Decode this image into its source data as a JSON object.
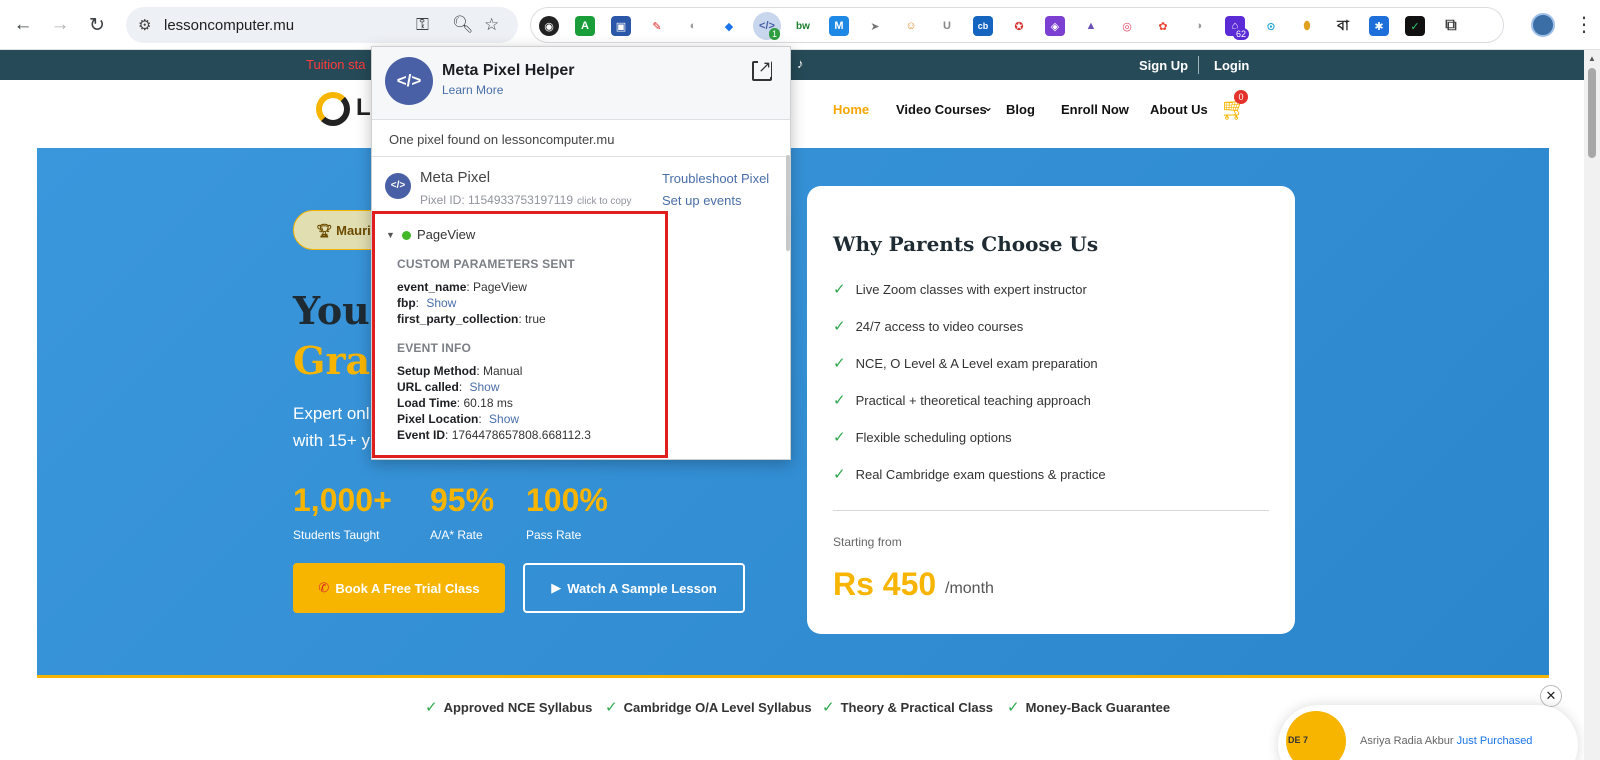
{
  "browser": {
    "url": "lessoncomputer.mu",
    "extension_badges": {
      "pixel": "1",
      "counter": "62"
    }
  },
  "site": {
    "announcement": "Tuition sta",
    "auth": {
      "signup": "Sign Up",
      "login": "Login"
    },
    "logo_text": "L",
    "nav": [
      {
        "label": "Home",
        "active": true
      },
      {
        "label": "Video Courses"
      },
      {
        "label": "Blog"
      },
      {
        "label": "Enroll Now"
      },
      {
        "label": "About Us"
      }
    ],
    "cart_count": "0"
  },
  "hero": {
    "pill_label": "Mauri",
    "heading_line1": "You",
    "heading_line2": "Grad",
    "subtitle_line1": "Expert onl",
    "subtitle_line2": "with 15+ y",
    "stats": [
      {
        "value": "1,000+",
        "label": "Students Taught"
      },
      {
        "value": "95%",
        "label": "A/A* Rate"
      },
      {
        "value": "100%",
        "label": "Pass Rate"
      }
    ],
    "cta_primary": "Book A Free Trial Class",
    "cta_secondary": "Watch A Sample Lesson"
  },
  "card": {
    "title": "Why Parents Choose Us",
    "features": [
      "Live Zoom classes with expert instructor",
      "24/7 access to video courses",
      "NCE, O Level & A Level exam preparation",
      "Practical + theoretical teaching approach",
      "Flexible scheduling options",
      "Real Cambridge exam questions & practice"
    ],
    "from_label": "Starting from",
    "price": "Rs 450",
    "price_unit": "/month"
  },
  "trust_bar": [
    "Approved NCE Syllabus",
    "Cambridge O/A Level Syllabus",
    "Theory & Practical Class",
    "Money-Back Guarantee"
  ],
  "toast": {
    "image_text": "DE 7",
    "name": "Asriya Radia Akbur",
    "action": "Just Purchased"
  },
  "pixel_helper": {
    "title": "Meta Pixel Helper",
    "learn_more": "Learn More",
    "found_text": "One pixel found on lessoncomputer.mu",
    "pixel_name": "Meta Pixel",
    "pixel_id": "Pixel ID: 1154933753197119",
    "click_to_copy": "click to copy",
    "troubleshoot": "Troubleshoot Pixel",
    "setup_events": "Set up events",
    "event": {
      "name": "PageView",
      "custom_section": "CUSTOM PARAMETERS SENT",
      "custom_params": [
        {
          "key": "event_name",
          "value": "PageView",
          "is_link": false
        },
        {
          "key": "fbp",
          "value": "Show",
          "is_link": true
        },
        {
          "key": "first_party_collection",
          "value": "true",
          "is_link": false
        }
      ],
      "info_section": "EVENT INFO",
      "info": [
        {
          "key": "Setup Method",
          "value": "Manual",
          "is_link": false
        },
        {
          "key": "URL called",
          "value": "Show",
          "is_link": true
        },
        {
          "key": "Load Time",
          "value": "60.18 ms",
          "is_link": false
        },
        {
          "key": "Pixel Location",
          "value": "Show",
          "is_link": true
        },
        {
          "key": "Event ID",
          "value": "1764478657808.668112.3",
          "is_link": false
        }
      ]
    }
  }
}
